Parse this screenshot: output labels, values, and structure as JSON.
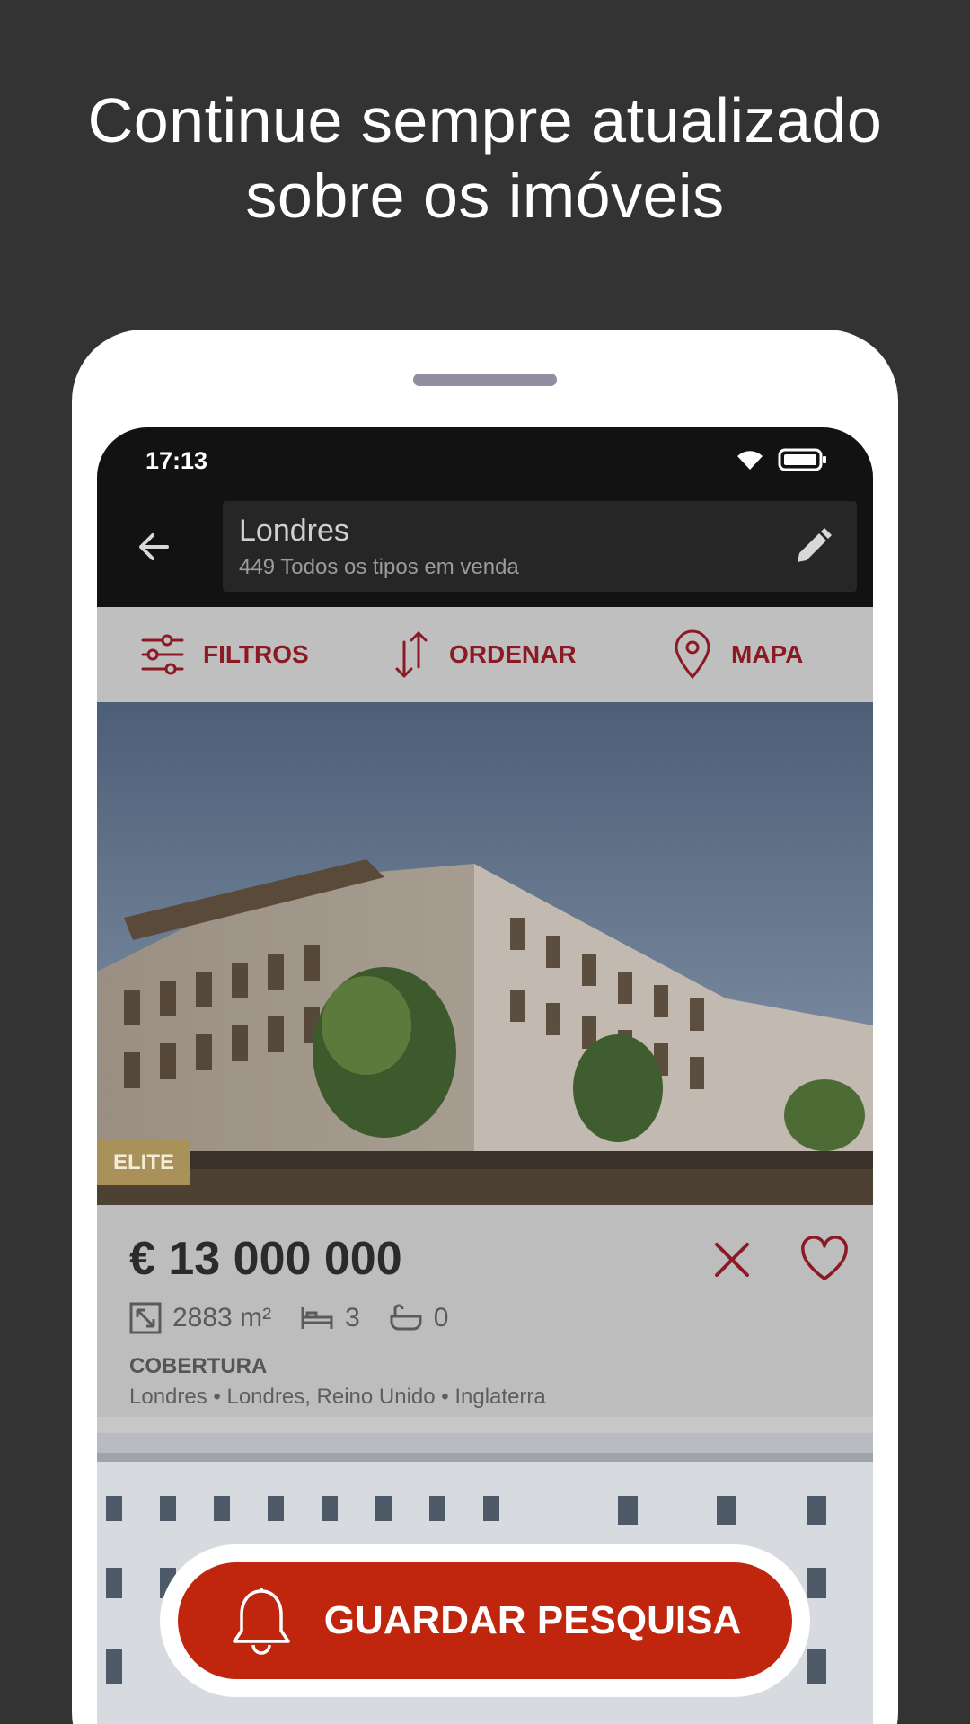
{
  "promo": {
    "headline_line1": "Continue sempre atualizado",
    "headline_line2": "sobre os imóveis"
  },
  "status_bar": {
    "time": "17:13",
    "icons": [
      "wifi-icon",
      "battery-icon"
    ]
  },
  "search": {
    "location": "Londres",
    "summary": "449 Todos os tipos em venda"
  },
  "toolbar": {
    "filters_label": "FILTROS",
    "sort_label": "ORDENAR",
    "map_label": "MAPA"
  },
  "listing": {
    "badge": "ELITE",
    "price": "€ 13 000 000",
    "area": "2883 m²",
    "bedrooms": "3",
    "bathrooms": "0",
    "type": "COBERTURA",
    "location": "Londres • Londres, Reino Unido • Inglaterra"
  },
  "cta": {
    "save_search_label": "GUARDAR PESQUISA"
  },
  "colors": {
    "background": "#333333",
    "accent": "#8c1a25",
    "cta": "#c0260e",
    "badge": "#a9925a"
  }
}
